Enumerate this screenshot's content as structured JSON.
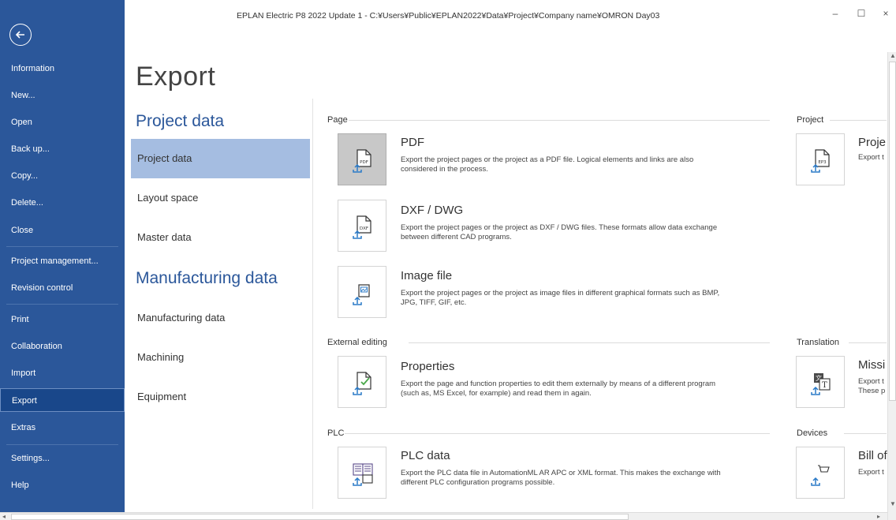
{
  "window": {
    "title": "EPLAN Electric P8 2022 Update 1 - C:¥Users¥Public¥EPLAN2022¥Data¥Project¥Company name¥OMRON Day03",
    "min": "–",
    "max": "☐",
    "close": "×"
  },
  "sidebar": {
    "items": [
      {
        "label": "Information"
      },
      {
        "label": "New..."
      },
      {
        "label": "Open"
      },
      {
        "label": "Back up..."
      },
      {
        "label": "Copy..."
      },
      {
        "label": "Delete..."
      },
      {
        "label": "Close"
      },
      {
        "label": "Project management..."
      },
      {
        "label": "Revision control"
      },
      {
        "label": "Print"
      },
      {
        "label": "Collaboration"
      },
      {
        "label": "Import"
      },
      {
        "label": "Export"
      },
      {
        "label": "Extras"
      },
      {
        "label": "Settings..."
      },
      {
        "label": "Help"
      }
    ],
    "active": "Export"
  },
  "page": {
    "title": "Export"
  },
  "categories": {
    "project_heading": "Project data",
    "project_items": [
      "Project data",
      "Layout space",
      "Master data"
    ],
    "manufacturing_heading": "Manufacturing data",
    "manufacturing_items": [
      "Manufacturing data",
      "Machining",
      "Equipment"
    ],
    "selected": "Project data"
  },
  "groups": {
    "page": "Page",
    "external": "External editing",
    "plc": "PLC",
    "project": "Project",
    "translation": "Translation",
    "devices": "Devices"
  },
  "items": {
    "pdf": {
      "title": "PDF",
      "desc": "Export the project pages or the project as a PDF file. Logical elements and links are also considered in the process.",
      "icon": "pdf-export-icon",
      "badge": "PDF"
    },
    "dxf": {
      "title": "DXF / DWG",
      "desc": "Export the project pages or the project as DXF / DWG files. These formats allow data exchange between different CAD programs.",
      "icon": "dxf-export-icon",
      "badge": "DXF"
    },
    "image": {
      "title": "Image file",
      "desc": "Export the project pages or the project as image files in different graphical formats such as BMP, JPG, TIFF, GIF, etc.",
      "icon": "image-export-icon"
    },
    "properties": {
      "title": "Properties",
      "desc": "Export the page and function properties to edit them externally by means of a different program (such as, MS Excel, for example) and read them in again.",
      "icon": "properties-export-icon"
    },
    "plc": {
      "title": "PLC data",
      "desc": "Export the PLC data file in AutomationML AR APC or XML format. This makes the exchange with different PLC configuration programs possible.",
      "icon": "plc-export-icon"
    },
    "project": {
      "title": "Proje",
      "desc": "Export t",
      "icon": "ep3-export-icon",
      "badge": "EP3"
    },
    "missing": {
      "title": "Missi",
      "desc1": "Export t",
      "desc2": "These p",
      "icon": "translation-export-icon"
    },
    "bom": {
      "title": "Bill of",
      "desc": "Export t",
      "icon": "bom-export-icon"
    }
  },
  "colors": {
    "sidebar": "#2b579a",
    "accent": "#2b579a",
    "selected_category": "#a5bde1"
  }
}
